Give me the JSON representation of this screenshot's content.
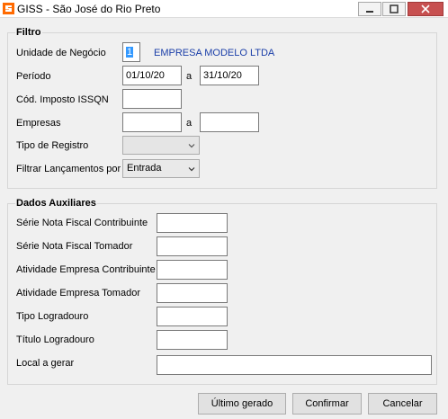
{
  "window": {
    "title": "GISS - São José do Rio Preto",
    "brand_color": "#ff6a00"
  },
  "filtro": {
    "title": "Filtro",
    "unidade_label": "Unidade de Negócio",
    "unidade_value": "1",
    "empresa_name": "EMPRESA MODELO LTDA",
    "periodo_label": "Período",
    "periodo_from": "01/10/20",
    "periodo_sep": "a",
    "periodo_to": "31/10/20",
    "imposto_label": "Cód. Imposto ISSQN",
    "imposto_value": "",
    "empresas_label": "Empresas",
    "empresas_sep": "a",
    "empresas_from": "",
    "empresas_to": "",
    "tipo_registro_label": "Tipo de Registro",
    "tipo_registro_value": "",
    "filtrar_label": "Filtrar Lançamentos por",
    "filtrar_value": "Entrada"
  },
  "auxiliares": {
    "title": "Dados Auxiliares",
    "serie_contribuinte_label": "Série Nota Fiscal Contribuinte",
    "serie_tomador_label": "Série Nota Fiscal Tomador",
    "atividade_contribuinte_label": "Atividade Empresa Contribuinte",
    "atividade_tomador_label": "Atividade Empresa Tomador",
    "tipo_logradouro_label": "Tipo Logradouro",
    "titulo_logradouro_label": "Título Logradouro",
    "local_gerar_label": "Local a gerar"
  },
  "buttons": {
    "ultimo_gerado": "Último gerado",
    "confirmar": "Confirmar",
    "cancelar": "Cancelar"
  }
}
